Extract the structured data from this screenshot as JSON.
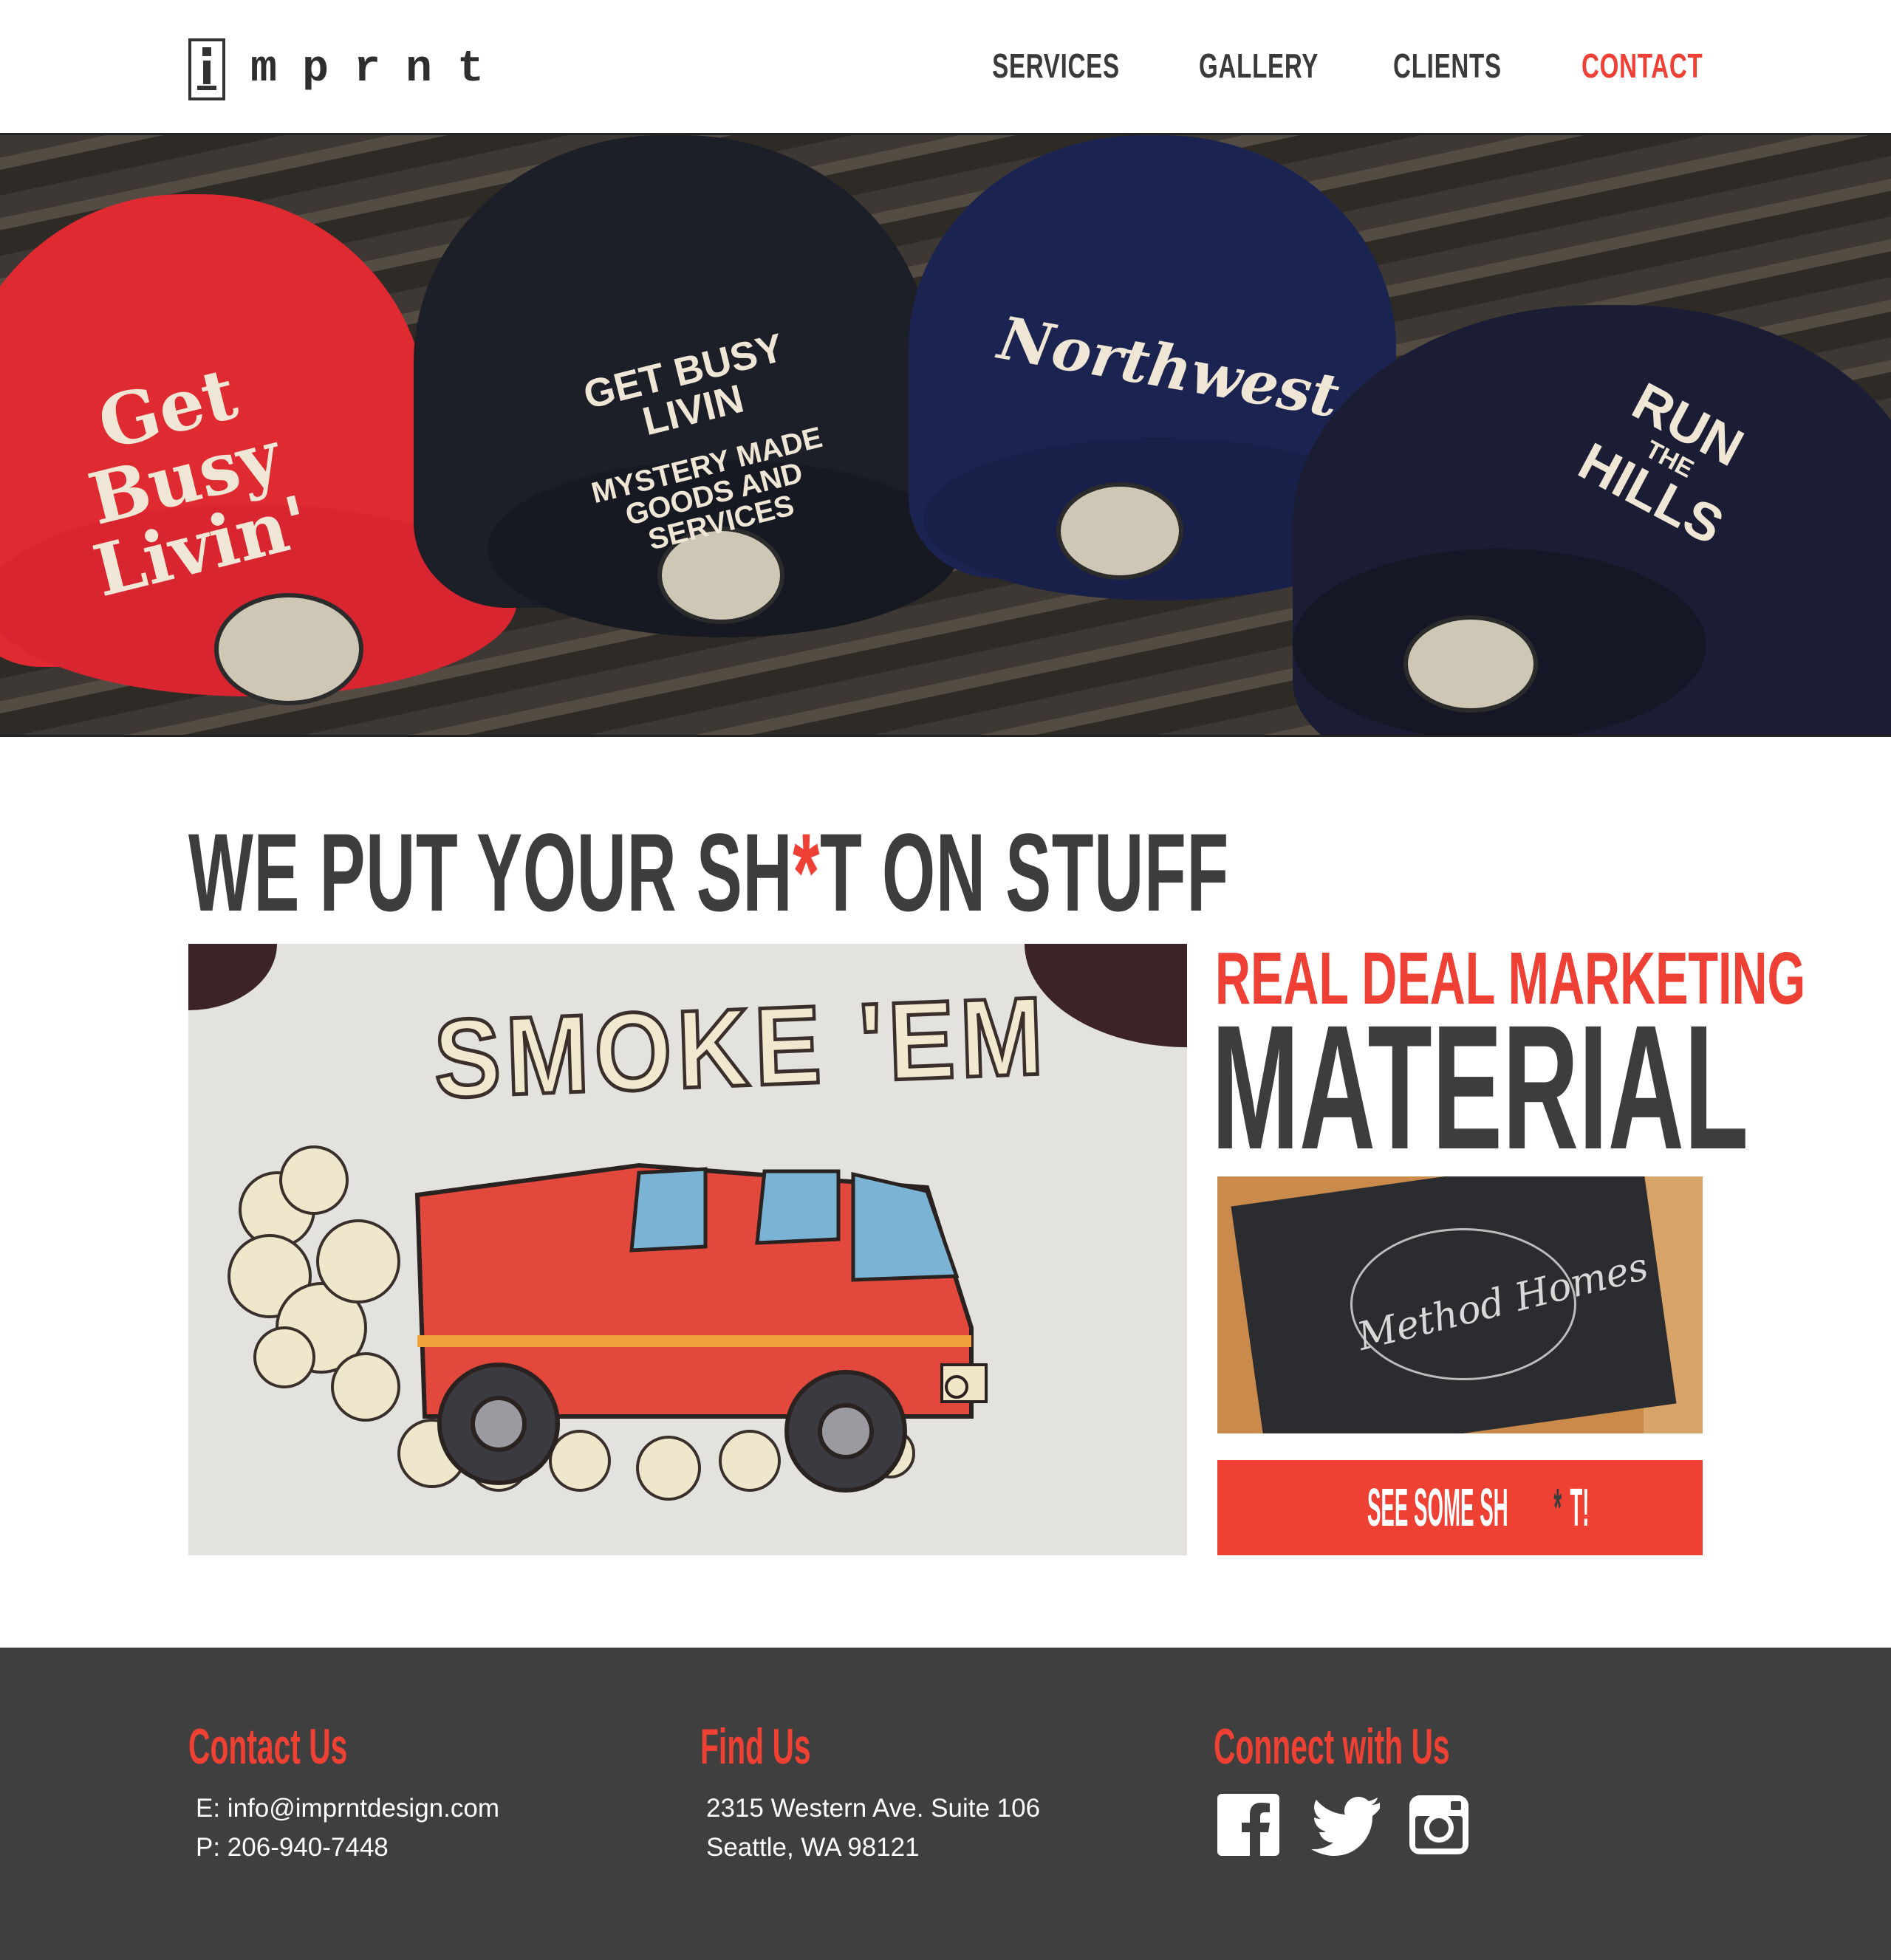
{
  "header": {
    "logo_text": "mprnt",
    "nav": [
      {
        "label": "SERVICES"
      },
      {
        "label": "GALLERY"
      },
      {
        "label": "CLIENTS"
      },
      {
        "label": "CONTACT"
      }
    ]
  },
  "hero": {
    "caps": [
      {
        "line1": "Get",
        "line2": "Busy",
        "line3": "Livin'"
      },
      {
        "line1": "GET BUSY LIVIN",
        "line2": "MYSTERY MADE",
        "line3": "GOODS AND SERVICES"
      },
      {
        "line1": "Northwest"
      },
      {
        "line1": "RUN",
        "line2": "THE",
        "line3": "HILLS"
      }
    ]
  },
  "main": {
    "headline_pre": "WE PUT YOUR SH",
    "headline_star": "*",
    "headline_post": "T ON STUFF",
    "feature_title": "SMOKE 'EM",
    "side_top": "REAL DEAL MARKETING",
    "side_big": "MATERIAL",
    "side_image_script": "Method Homes",
    "cta_pre": "SEE SOME SH",
    "cta_star": "*",
    "cta_post": "T!"
  },
  "footer": {
    "contact": {
      "heading": "Contact Us",
      "email": "E: info@imprntdesign.com",
      "phone": "P: 206-940-7448"
    },
    "find": {
      "heading": "Find Us",
      "address1": "2315 Western Ave. Suite 106",
      "address2": "Seattle, WA 98121"
    },
    "connect": {
      "heading": "Connect with Us",
      "icons": [
        "facebook-icon",
        "twitter-icon",
        "instagram-icon"
      ]
    }
  },
  "colors": {
    "accent": "#ef4034",
    "dark": "#3d3d3d",
    "footer_bg": "#3f3f40"
  }
}
